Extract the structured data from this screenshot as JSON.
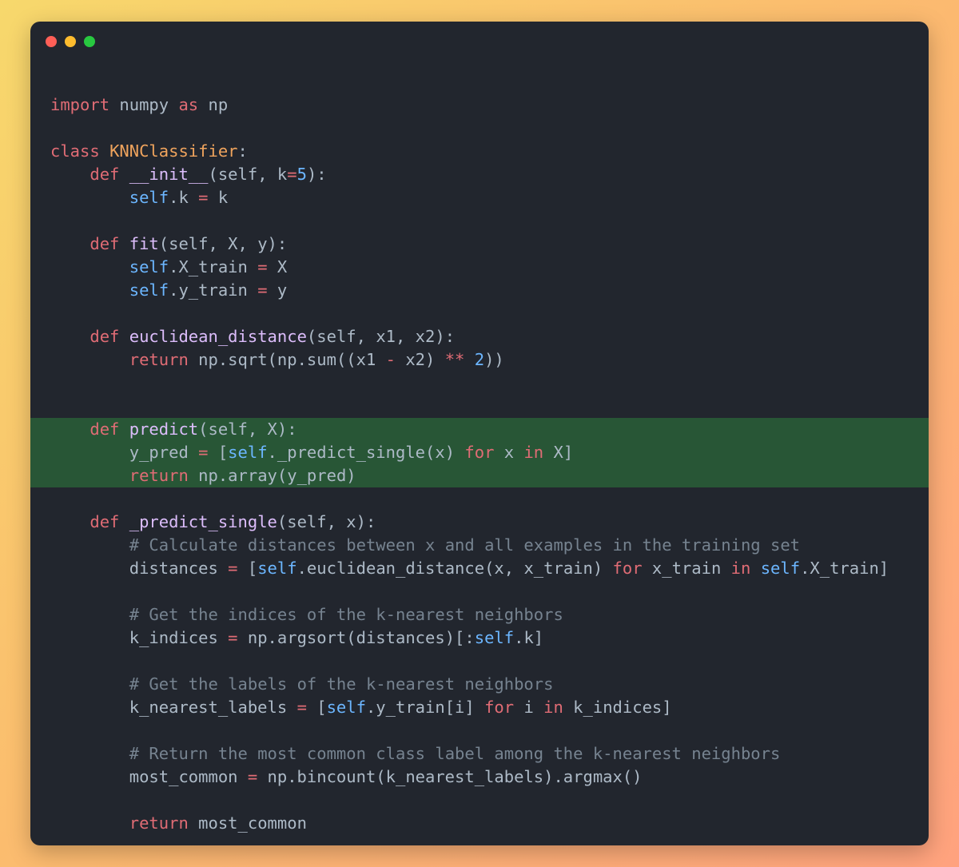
{
  "window": {
    "controls": [
      {
        "name": "close",
        "color": "#ff5f57"
      },
      {
        "name": "minimize",
        "color": "#febc2e"
      },
      {
        "name": "maximize",
        "color": "#28c840"
      }
    ]
  },
  "highlight_color": "#285636",
  "code": {
    "language": "python",
    "highlighted_lines": [
      14,
      15,
      16
    ],
    "lines": [
      [
        [
          "keyword",
          "import"
        ],
        [
          "plain",
          " numpy "
        ],
        [
          "keyword",
          "as"
        ],
        [
          "plain",
          " np"
        ]
      ],
      [],
      [
        [
          "keyword",
          "class"
        ],
        [
          "plain",
          " "
        ],
        [
          "cls",
          "KNNClassifier"
        ],
        [
          "plain",
          ":"
        ]
      ],
      [
        [
          "plain",
          "    "
        ],
        [
          "keyword",
          "def"
        ],
        [
          "plain",
          " "
        ],
        [
          "fn",
          "__init__"
        ],
        [
          "plain",
          "(self, k"
        ],
        [
          "op",
          "="
        ],
        [
          "num",
          "5"
        ],
        [
          "plain",
          "):"
        ]
      ],
      [
        [
          "plain",
          "        "
        ],
        [
          "self",
          "self"
        ],
        [
          "plain",
          ".k "
        ],
        [
          "op",
          "="
        ],
        [
          "plain",
          " k"
        ]
      ],
      [],
      [
        [
          "plain",
          "    "
        ],
        [
          "keyword",
          "def"
        ],
        [
          "plain",
          " "
        ],
        [
          "fn",
          "fit"
        ],
        [
          "plain",
          "(self, X, y):"
        ]
      ],
      [
        [
          "plain",
          "        "
        ],
        [
          "self",
          "self"
        ],
        [
          "plain",
          ".X_train "
        ],
        [
          "op",
          "="
        ],
        [
          "plain",
          " X"
        ]
      ],
      [
        [
          "plain",
          "        "
        ],
        [
          "self",
          "self"
        ],
        [
          "plain",
          ".y_train "
        ],
        [
          "op",
          "="
        ],
        [
          "plain",
          " y"
        ]
      ],
      [],
      [
        [
          "plain",
          "    "
        ],
        [
          "keyword",
          "def"
        ],
        [
          "plain",
          " "
        ],
        [
          "fn",
          "euclidean_distance"
        ],
        [
          "plain",
          "(self, x1, x2):"
        ]
      ],
      [
        [
          "plain",
          "        "
        ],
        [
          "keyword",
          "return"
        ],
        [
          "plain",
          " np.sqrt(np.sum((x1 "
        ],
        [
          "op",
          "-"
        ],
        [
          "plain",
          " x2) "
        ],
        [
          "op",
          "**"
        ],
        [
          "plain",
          " "
        ],
        [
          "num",
          "2"
        ],
        [
          "plain",
          "))"
        ]
      ],
      [],
      [],
      [
        [
          "plain",
          "    "
        ],
        [
          "keyword",
          "def"
        ],
        [
          "plain",
          " "
        ],
        [
          "fn",
          "predict"
        ],
        [
          "plain",
          "(self, X):"
        ]
      ],
      [
        [
          "plain",
          "        y_pred "
        ],
        [
          "op",
          "="
        ],
        [
          "plain",
          " ["
        ],
        [
          "self",
          "self"
        ],
        [
          "plain",
          "._predict_single(x) "
        ],
        [
          "keyword",
          "for"
        ],
        [
          "plain",
          " x "
        ],
        [
          "keyword",
          "in"
        ],
        [
          "plain",
          " X]"
        ]
      ],
      [
        [
          "plain",
          "        "
        ],
        [
          "keyword",
          "return"
        ],
        [
          "plain",
          " np.array(y_pred)"
        ]
      ],
      [],
      [
        [
          "plain",
          "    "
        ],
        [
          "keyword",
          "def"
        ],
        [
          "plain",
          " "
        ],
        [
          "fn",
          "_predict_single"
        ],
        [
          "plain",
          "(self, x):"
        ]
      ],
      [
        [
          "plain",
          "        "
        ],
        [
          "comment",
          "# Calculate distances between x and all examples in the training set"
        ]
      ],
      [
        [
          "plain",
          "        distances "
        ],
        [
          "op",
          "="
        ],
        [
          "plain",
          " ["
        ],
        [
          "self",
          "self"
        ],
        [
          "plain",
          ".euclidean_distance(x, x_train) "
        ],
        [
          "keyword",
          "for"
        ],
        [
          "plain",
          " x_train "
        ],
        [
          "keyword",
          "in"
        ],
        [
          "plain",
          " "
        ],
        [
          "self",
          "self"
        ],
        [
          "plain",
          ".X_train]"
        ]
      ],
      [],
      [
        [
          "plain",
          "        "
        ],
        [
          "comment",
          "# Get the indices of the k-nearest neighbors"
        ]
      ],
      [
        [
          "plain",
          "        k_indices "
        ],
        [
          "op",
          "="
        ],
        [
          "plain",
          " np.argsort(distances)[:"
        ],
        [
          "self",
          "self"
        ],
        [
          "plain",
          ".k]"
        ]
      ],
      [],
      [
        [
          "plain",
          "        "
        ],
        [
          "comment",
          "# Get the labels of the k-nearest neighbors"
        ]
      ],
      [
        [
          "plain",
          "        k_nearest_labels "
        ],
        [
          "op",
          "="
        ],
        [
          "plain",
          " ["
        ],
        [
          "self",
          "self"
        ],
        [
          "plain",
          ".y_train[i] "
        ],
        [
          "keyword",
          "for"
        ],
        [
          "plain",
          " i "
        ],
        [
          "keyword",
          "in"
        ],
        [
          "plain",
          " k_indices]"
        ]
      ],
      [],
      [
        [
          "plain",
          "        "
        ],
        [
          "comment",
          "# Return the most common class label among the k-nearest neighbors"
        ]
      ],
      [
        [
          "plain",
          "        most_common "
        ],
        [
          "op",
          "="
        ],
        [
          "plain",
          " np.bincount(k_nearest_labels).argmax()"
        ]
      ],
      [],
      [
        [
          "plain",
          "        "
        ],
        [
          "keyword",
          "return"
        ],
        [
          "plain",
          " most_common"
        ]
      ]
    ]
  }
}
